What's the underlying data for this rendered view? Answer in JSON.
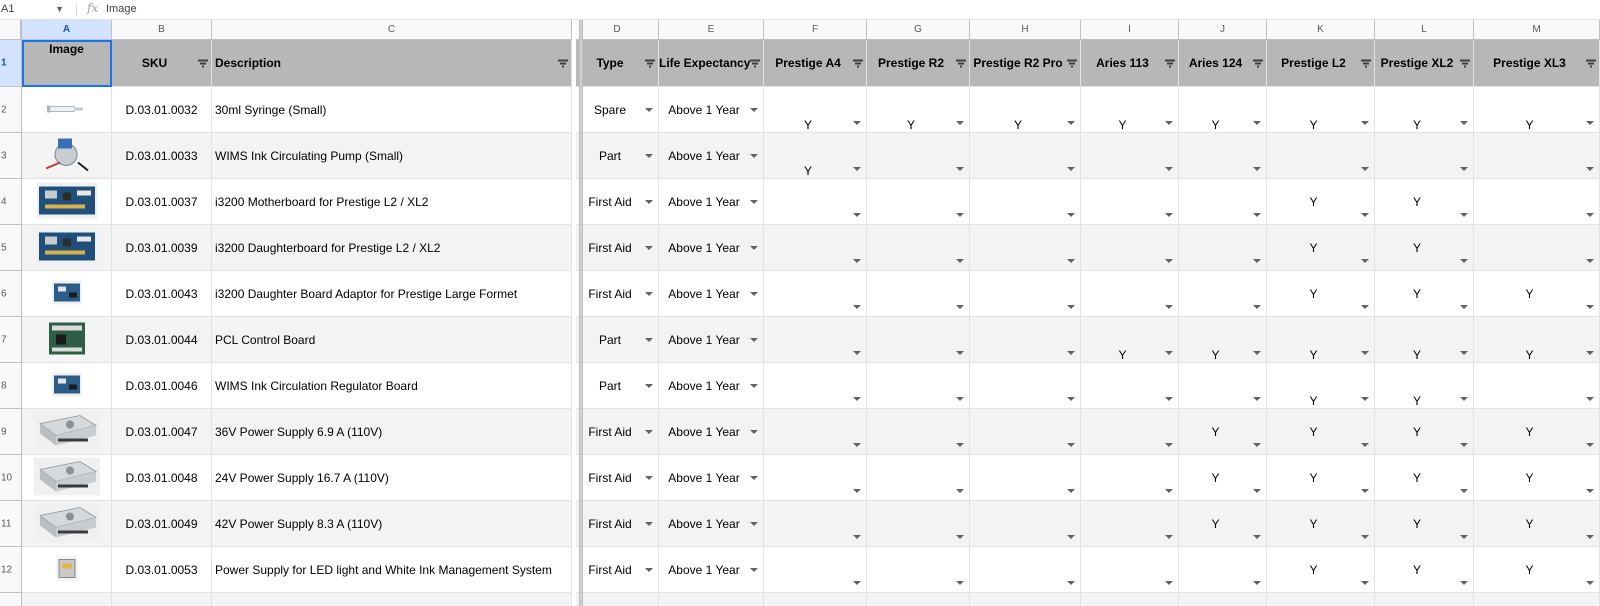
{
  "formula_bar": {
    "cell_ref": "A1",
    "fx_label": "fx",
    "value": "Image"
  },
  "columns": [
    "A",
    "B",
    "C",
    "D",
    "E",
    "F",
    "G",
    "H",
    "I",
    "J",
    "K",
    "L",
    "M"
  ],
  "row_numbers": [
    "1",
    "2",
    "3",
    "4",
    "5",
    "6",
    "7",
    "8",
    "9",
    "10",
    "11",
    "12"
  ],
  "headers": {
    "image": "Image",
    "sku": "SKU",
    "description": "Description",
    "type": "Type",
    "life": "Life Expectancy",
    "models": [
      "Prestige A4",
      "Prestige R2",
      "Prestige R2 Pro",
      "Aries 113",
      "Aries 124",
      "Prestige L2",
      "Prestige XL2",
      "Prestige XL3"
    ]
  },
  "rows": [
    {
      "sku": "D.03.01.0032",
      "description": "30ml Syringe (Small)",
      "type": "Spare",
      "life": "Above 1 Year",
      "thumb": "syringe",
      "models": [
        "Y",
        "Y",
        "Y",
        "Y",
        "Y",
        "Y",
        "Y",
        "Y"
      ],
      "ypos": "low"
    },
    {
      "sku": "D.03.01.0033",
      "description": "WIMS Ink Circulating Pump (Small)",
      "type": "Part",
      "life": "Above 1 Year",
      "thumb": "pump",
      "models": [
        "Y",
        "",
        "",
        "",
        "",
        "",
        "",
        ""
      ],
      "ypos": "low"
    },
    {
      "sku": "D.03.01.0037",
      "description": "i3200 Motherboard for Prestige L2 / XL2",
      "type": "First Aid",
      "life": "Above 1 Year",
      "thumb": "board",
      "models": [
        "",
        "",
        "",
        "",
        "",
        "Y",
        "Y",
        ""
      ],
      "ypos": "mid"
    },
    {
      "sku": "D.03.01.0039",
      "description": "i3200 Daughterboard for Prestige L2 / XL2",
      "type": "First Aid",
      "life": "Above 1 Year",
      "thumb": "board",
      "models": [
        "",
        "",
        "",
        "",
        "",
        "Y",
        "Y",
        ""
      ],
      "ypos": "mid"
    },
    {
      "sku": "D.03.01.0043",
      "description": "i3200 Daughter Board Adaptor for Prestige Large Formet",
      "type": "First Aid",
      "life": "Above 1 Year",
      "thumb": "smallboard",
      "models": [
        "",
        "",
        "",
        "",
        "",
        "Y",
        "Y",
        "Y"
      ],
      "ypos": "mid"
    },
    {
      "sku": "D.03.01.0044",
      "description": "PCL Control Board",
      "type": "Part",
      "life": "Above 1 Year",
      "thumb": "greenboard",
      "models": [
        "",
        "",
        "",
        "Y",
        "Y",
        "Y",
        "Y",
        "Y"
      ],
      "ypos": "low"
    },
    {
      "sku": "D.03.01.0046",
      "description": "WIMS Ink Circulation Regulator Board",
      "type": "Part",
      "life": "Above 1 Year",
      "thumb": "smallboard",
      "models": [
        "",
        "",
        "",
        "",
        "",
        "Y",
        "Y",
        ""
      ],
      "ypos": "low"
    },
    {
      "sku": "D.03.01.0047",
      "description": "36V Power Supply 6.9 A (110V)",
      "type": "First Aid",
      "life": "Above 1 Year",
      "thumb": "psu",
      "models": [
        "",
        "",
        "",
        "",
        "Y",
        "Y",
        "Y",
        "Y"
      ],
      "ypos": "mid"
    },
    {
      "sku": "D.03.01.0048",
      "description": "24V Power Supply 16.7 A (110V)",
      "type": "First Aid",
      "life": "Above 1 Year",
      "thumb": "psu",
      "models": [
        "",
        "",
        "",
        "",
        "Y",
        "Y",
        "Y",
        "Y"
      ],
      "ypos": "mid"
    },
    {
      "sku": "D.03.01.0049",
      "description": "42V Power Supply 8.3 A (110V)",
      "type": "First Aid",
      "life": "Above 1 Year",
      "thumb": "psu",
      "models": [
        "",
        "",
        "",
        "",
        "Y",
        "Y",
        "Y",
        "Y"
      ],
      "ypos": "mid"
    },
    {
      "sku": "D.03.01.0053",
      "description": "Power Supply for LED light and White Ink Management System",
      "type": "First Aid",
      "life": "Above 1 Year",
      "thumb": "smallbox",
      "models": [
        "",
        "",
        "",
        "",
        "",
        "Y",
        "Y",
        "Y"
      ],
      "ypos": "mid"
    }
  ],
  "colors": {
    "header_bg": "#b7b7b7",
    "stripe": "#f3f3f3",
    "selection": "#1a73e8"
  }
}
